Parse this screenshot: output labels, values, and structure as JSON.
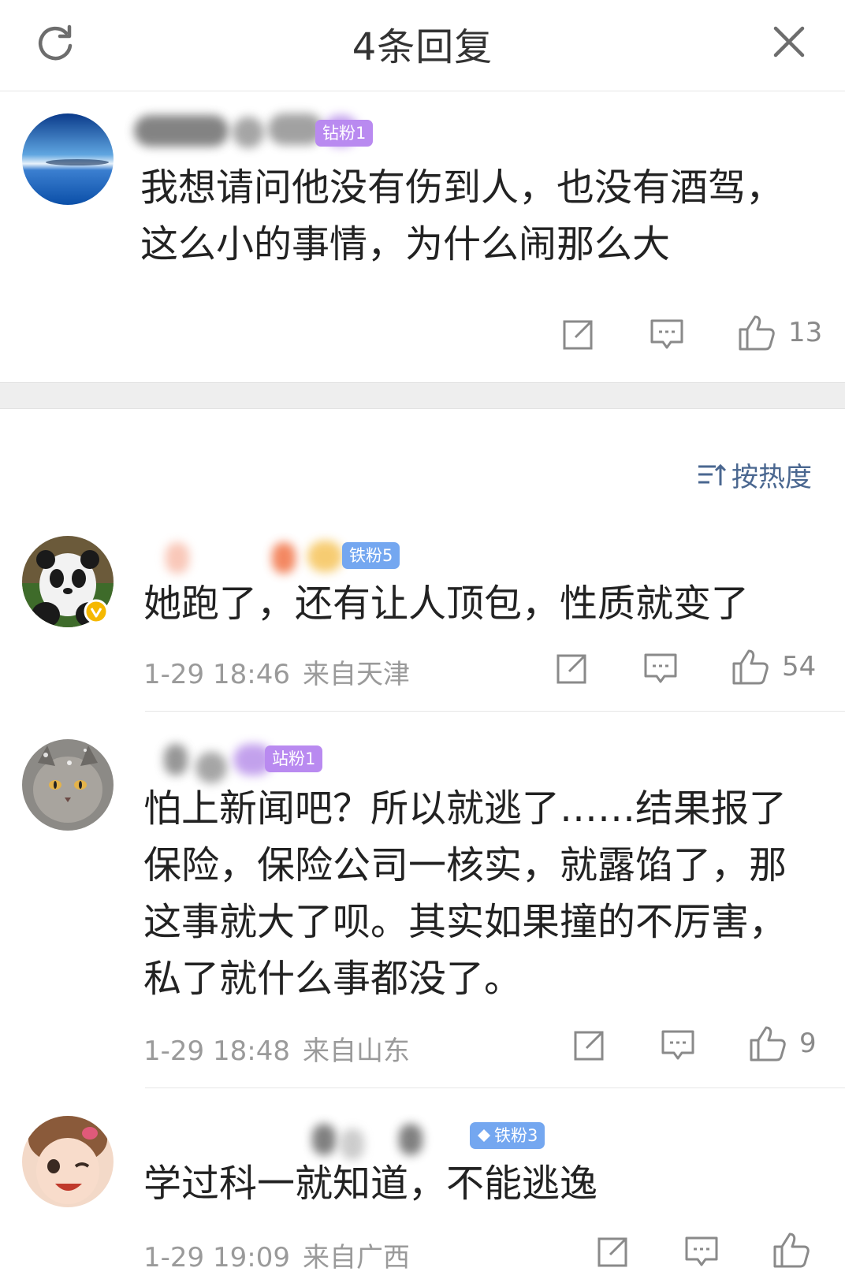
{
  "header": {
    "title": "4条回复",
    "refresh_icon": "refresh-icon",
    "close_icon": "close-icon"
  },
  "main_comment": {
    "badge": "钻粉1",
    "text": "我想请问他没有伤到人，也没有酒驾，这么小的事情，为什么闹那么大",
    "likes": "13"
  },
  "sort": {
    "icon": "sort-icon",
    "label": "按热度"
  },
  "replies": [
    {
      "badge": "铁粉5",
      "text": "她跑了，还有让人顶包，性质就变了",
      "time": "1-29 18:46",
      "location": "来自天津",
      "likes": "54"
    },
    {
      "badge": "站粉1",
      "text": "怕上新闻吧？所以就逃了……结果报了保险，保险公司一核实，就露馅了，那这事就大了呗。其实如果撞的不厉害，私了就什么事都没了。",
      "time": "1-29 18:48",
      "location": "来自山东",
      "likes": "9"
    },
    {
      "badge": "铁粉3",
      "text": "学过科一就知道，不能逃逸",
      "time": "1-29 19:09",
      "location": "来自广西",
      "likes": ""
    }
  ],
  "colors": {
    "badge_purple": "#b98af0",
    "badge_blue": "#74a7f0",
    "sort_text": "#4a6790",
    "meta_text": "#9a9a9a"
  }
}
